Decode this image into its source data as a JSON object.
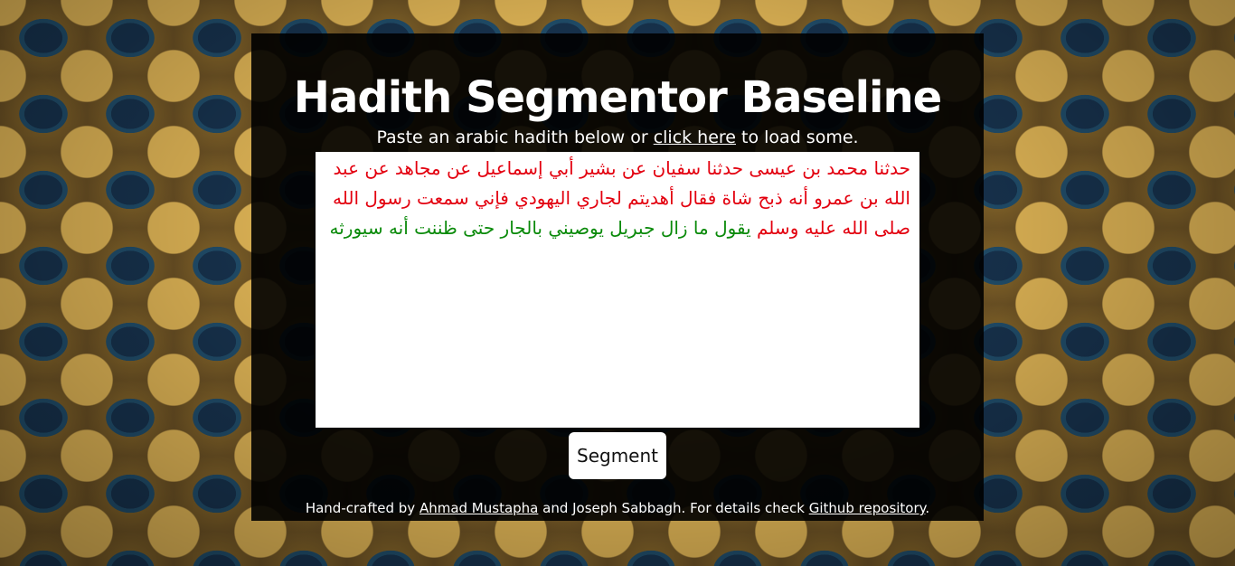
{
  "header": {
    "title": "Hadith Segmentor Baseline"
  },
  "instructions": {
    "prefix": "Paste an arabic hadith below or ",
    "link_label": "click here",
    "suffix": " to load some."
  },
  "hadith_input": {
    "segments": [
      {
        "text": "حدثنا محمد بن عيسى حدثنا سفيان عن بشير أبي إسماعيل عن مجاهد عن عبد الله بن عمرو أنه ذبح شاة فقال أهديتم لجاري اليهودي فإني سمعت رسول الله صلى الله عليه وسلم ",
        "color": "#e3000f"
      },
      {
        "text": "يقول ما زال جبريل يوصيني بالجار حتى ظننت أنه سيورثه",
        "color": "#0a8a0a"
      }
    ]
  },
  "actions": {
    "segment_label": "Segment"
  },
  "footer": {
    "prefix": "Hand-crafted by ",
    "author_link": "Ahmad Mustapha",
    "middle": " and Joseph Sabbagh. For details check ",
    "repo_link": "Github repository",
    "suffix": "."
  }
}
